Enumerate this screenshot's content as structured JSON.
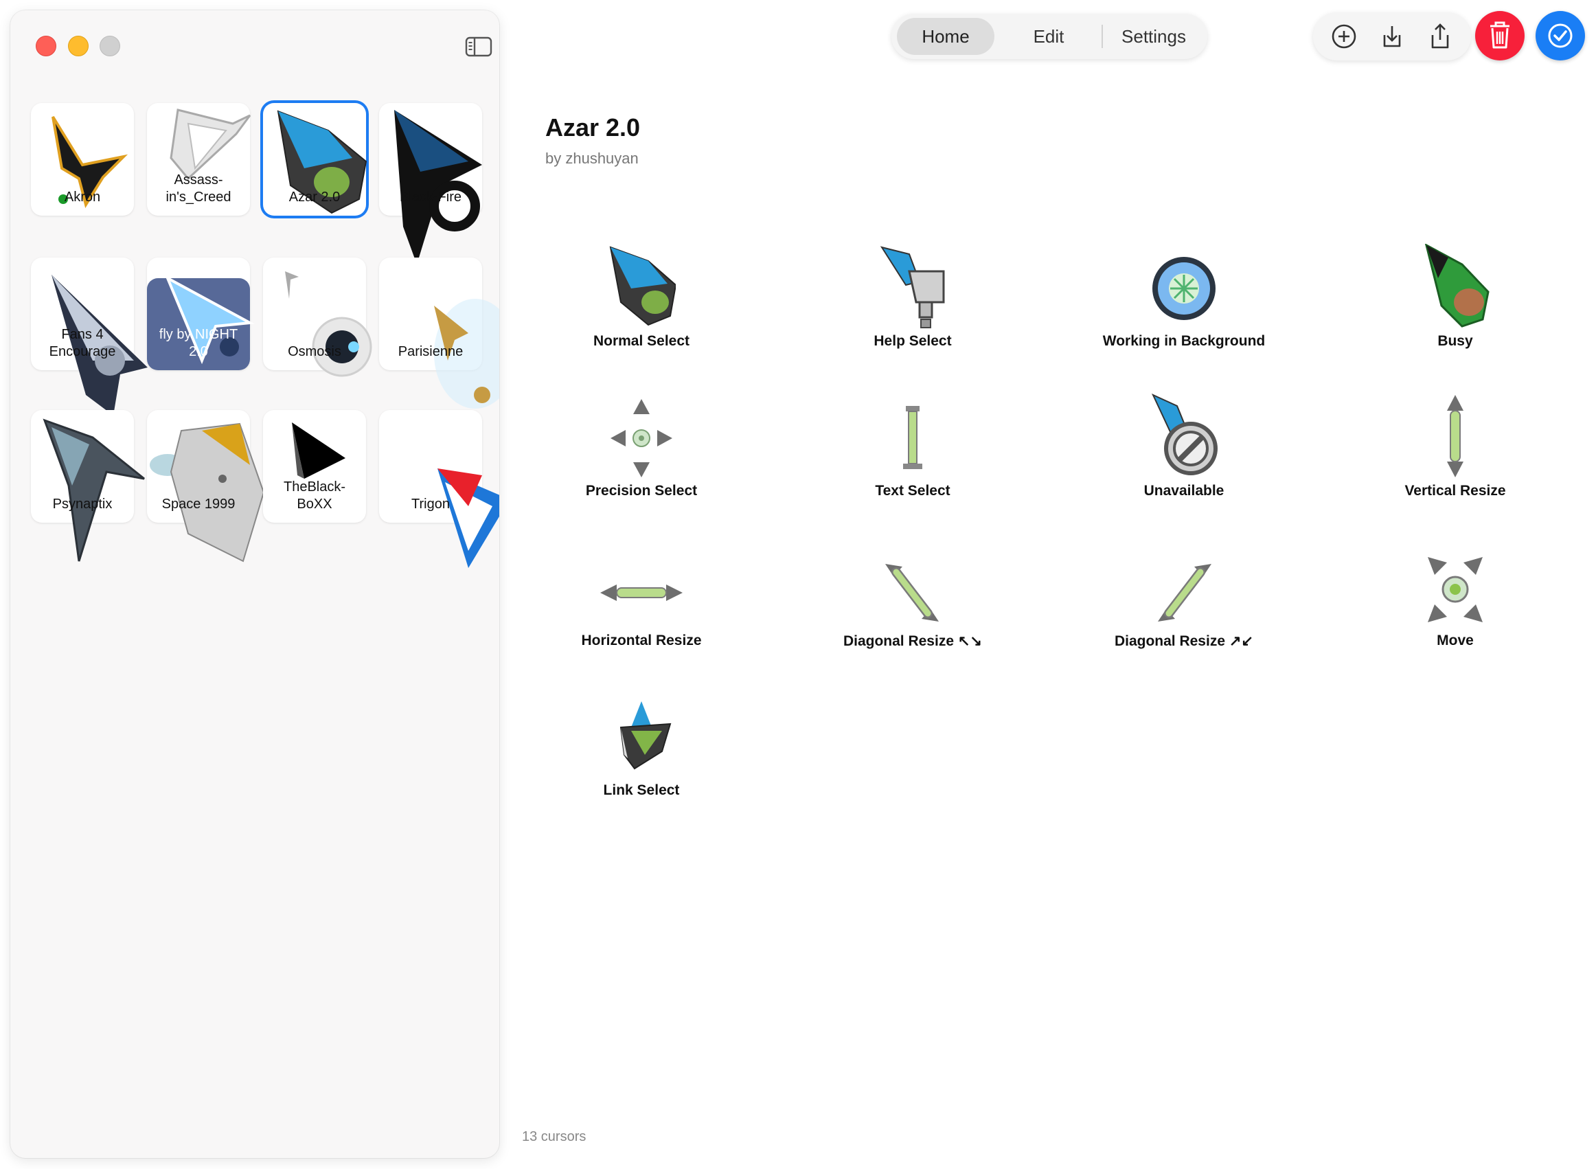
{
  "window": {
    "traffic_lights": [
      "close",
      "minimize",
      "zoom"
    ]
  },
  "sidebar": {
    "toggle_icon": "sidebar-left-icon",
    "items": [
      {
        "label": "Akron",
        "icon": "akron-cursor-preview"
      },
      {
        "label": "Assass-\nin's_Creed",
        "icon": "assassins-creed-cursor-preview"
      },
      {
        "label": "Azar 2.0",
        "icon": "azar-cursor-preview",
        "selected": true
      },
      {
        "label": "Black-Fire",
        "icon": "blackfire-cursor-preview"
      },
      {
        "label": "Fans 4\nEncourage",
        "icon": "fans4encourage-cursor-preview"
      },
      {
        "label": "fly by NIGHT\n2.0",
        "icon": "fly-by-night-cursor-preview"
      },
      {
        "label": "Osmosis",
        "icon": "osmosis-cursor-preview"
      },
      {
        "label": "Parisienne",
        "icon": "parisienne-cursor-preview"
      },
      {
        "label": "Psynaptix",
        "icon": "psynaptix-cursor-preview"
      },
      {
        "label": "Space 1999",
        "icon": "space-1999-cursor-preview"
      },
      {
        "label": "TheBlack-\nBoXX",
        "icon": "theblackboxx-cursor-preview"
      },
      {
        "label": "Trigon",
        "icon": "trigon-cursor-preview"
      }
    ]
  },
  "toolbar": {
    "tabs": [
      {
        "label": "Home",
        "active": true
      },
      {
        "label": "Edit",
        "active": false
      },
      {
        "label": "Settings",
        "active": false
      }
    ],
    "actions": [
      "add-circle-icon",
      "download-icon",
      "share-icon"
    ],
    "delete_icon": "trash-icon",
    "apply_icon": "checkmark-icon"
  },
  "main": {
    "title": "Azar 2.0",
    "author": "by zhushuyan",
    "cursors": [
      {
        "label": "Normal Select",
        "icon": "normal-select-cursor-icon"
      },
      {
        "label": "Help Select",
        "icon": "help-select-cursor-icon"
      },
      {
        "label": "Working in Background",
        "icon": "working-in-background-cursor-icon"
      },
      {
        "label": "Busy",
        "icon": "busy-cursor-icon"
      },
      {
        "label": "Precision Select",
        "icon": "precision-select-cursor-icon"
      },
      {
        "label": "Text Select",
        "icon": "text-select-cursor-icon"
      },
      {
        "label": "Unavailable",
        "icon": "unavailable-cursor-icon"
      },
      {
        "label": "Vertical Resize",
        "icon": "vertical-resize-cursor-icon"
      },
      {
        "label": "Horizontal Resize",
        "icon": "horizontal-resize-cursor-icon"
      },
      {
        "label": "Diagonal Resize ↖↘",
        "icon": "diagonal-resize-nwse-cursor-icon"
      },
      {
        "label": "Diagonal Resize ↗↙",
        "icon": "diagonal-resize-nesw-cursor-icon"
      },
      {
        "label": "Move",
        "icon": "move-cursor-icon"
      },
      {
        "label": "Link Select",
        "icon": "link-select-cursor-icon"
      }
    ],
    "footer": "13 cursors"
  },
  "colors": {
    "accent": "#1d7cf2",
    "delete": "#f7203a",
    "apply": "#1a7ef5",
    "sidebar_bg": "#f8f7f7"
  }
}
